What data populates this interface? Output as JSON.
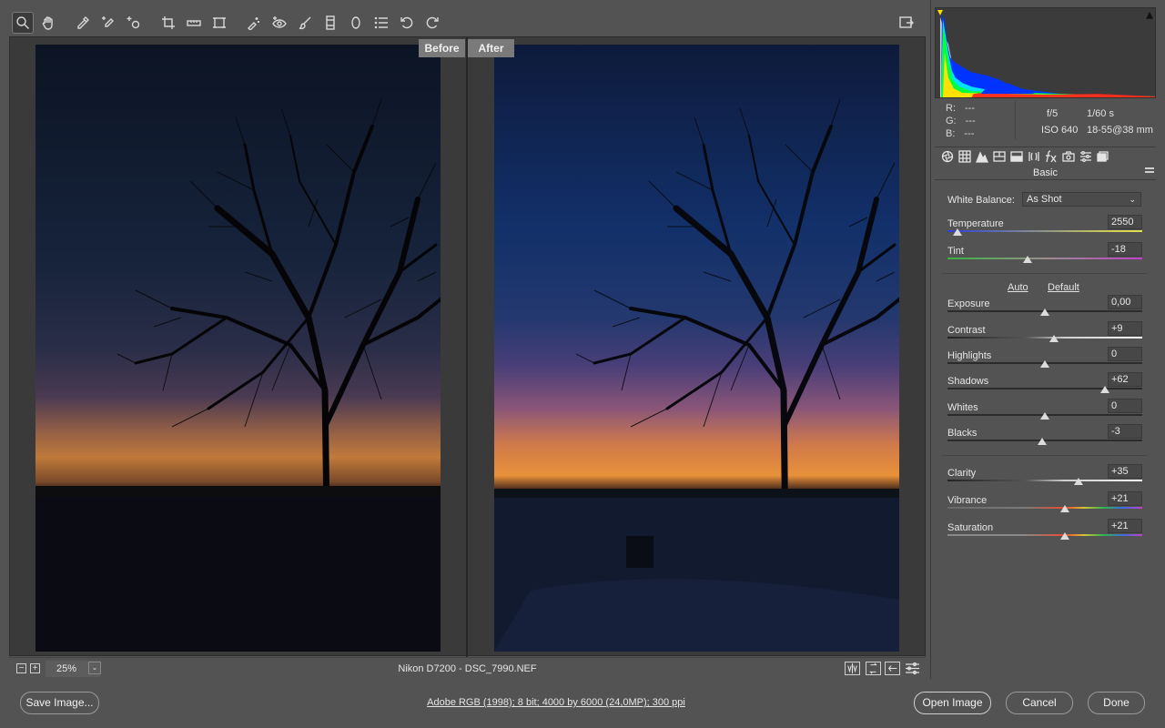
{
  "toolbar": {
    "tools": [
      {
        "name": "zoom-tool",
        "icon": "magnifier-icon",
        "active": true
      },
      {
        "name": "hand-tool",
        "icon": "hand-icon"
      },
      {
        "name": "white-balance-tool",
        "icon": "eyedropper-icon"
      },
      {
        "name": "color-sampler-tool",
        "icon": "eyedropper-plus-icon"
      },
      {
        "name": "targeted-adjustment-tool",
        "icon": "target-icon"
      },
      {
        "name": "crop-tool",
        "icon": "crop-icon"
      },
      {
        "name": "straighten-tool",
        "icon": "level-icon"
      },
      {
        "name": "transform-tool",
        "icon": "transform-icon"
      },
      {
        "name": "spot-removal-tool",
        "icon": "brush-sparkle-icon"
      },
      {
        "name": "red-eye-tool",
        "icon": "eye-icon"
      },
      {
        "name": "adjustment-brush",
        "icon": "brush-icon"
      },
      {
        "name": "graduated-filter",
        "icon": "gradient-icon"
      },
      {
        "name": "radial-filter",
        "icon": "ellipse-icon"
      },
      {
        "name": "preferences",
        "icon": "list-icon"
      },
      {
        "name": "rotate-ccw",
        "icon": "rotate-left-icon"
      },
      {
        "name": "rotate-cw",
        "icon": "rotate-right-icon"
      }
    ]
  },
  "preview": {
    "before_label": "Before",
    "after_label": "After"
  },
  "statusbar": {
    "zoom_minus": "−",
    "zoom_plus": "+",
    "zoom_value": "25%",
    "file_info": "Nikon D7200  -  DSC_7990.NEF"
  },
  "panel": {
    "readout": {
      "r_label": "R:",
      "g_label": "G:",
      "b_label": "B:",
      "r": "---",
      "g": "---",
      "b": "---"
    },
    "exif": {
      "aperture": "f/5",
      "shutter": "1/60 s",
      "iso": "ISO 640",
      "lens": "18-55@38 mm"
    },
    "title": "Basic",
    "white_balance": {
      "label": "White Balance:",
      "value": "As Shot"
    },
    "auto_label": "Auto",
    "default_label": "Default",
    "adjustments": [
      {
        "key": "temperature",
        "label": "Temperature",
        "value": "2550",
        "pos": 0.05,
        "track": "temp"
      },
      {
        "key": "tint",
        "label": "Tint",
        "value": "-18",
        "pos": 0.41,
        "track": "tint"
      },
      {
        "key": "exposure",
        "label": "Exposure",
        "value": "0,00",
        "pos": 0.5,
        "track": "plain"
      },
      {
        "key": "contrast",
        "label": "Contrast",
        "value": "+9",
        "pos": 0.545,
        "track": "contrast"
      },
      {
        "key": "highlights",
        "label": "Highlights",
        "value": "0",
        "pos": 0.5,
        "track": "plain"
      },
      {
        "key": "shadows",
        "label": "Shadows",
        "value": "+62",
        "pos": 0.81,
        "track": "plain"
      },
      {
        "key": "whites",
        "label": "Whites",
        "value": "0",
        "pos": 0.5,
        "track": "plain"
      },
      {
        "key": "blacks",
        "label": "Blacks",
        "value": "-3",
        "pos": 0.485,
        "track": "plain"
      },
      {
        "key": "clarity",
        "label": "Clarity",
        "value": "+35",
        "pos": 0.675,
        "track": "contrast"
      },
      {
        "key": "vibrance",
        "label": "Vibrance",
        "value": "+21",
        "pos": 0.605,
        "track": "vib"
      },
      {
        "key": "saturation",
        "label": "Saturation",
        "value": "+21",
        "pos": 0.605,
        "track": "sat"
      }
    ]
  },
  "bottombar": {
    "save_label": "Save Image...",
    "workflow_text": "Adobe RGB (1998); 8 bit; 4000 by 6000 (24,0MP); 300 ppi",
    "open_label": "Open Image",
    "cancel_label": "Cancel",
    "done_label": "Done"
  }
}
